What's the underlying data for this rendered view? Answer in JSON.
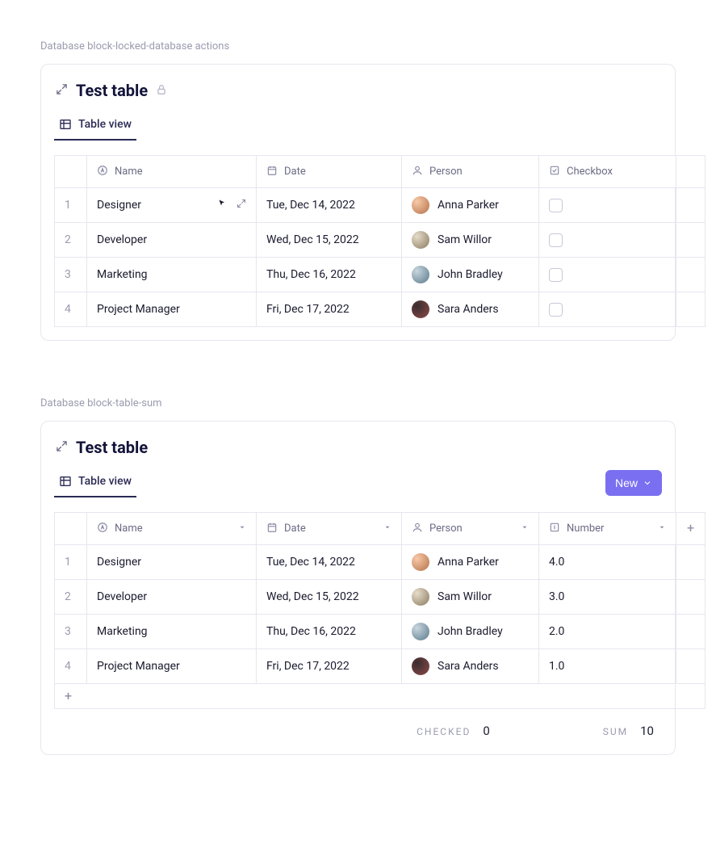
{
  "section1": {
    "caption": "Database block-locked-database actions",
    "title": "Test table",
    "tab": "Table view",
    "columns": {
      "name": "Name",
      "date": "Date",
      "person": "Person",
      "checkbox": "Checkbox"
    },
    "rows": [
      {
        "idx": "1",
        "name": "Designer",
        "date": "Tue, Dec 14, 2022",
        "person": "Anna Parker"
      },
      {
        "idx": "2",
        "name": "Developer",
        "date": "Wed, Dec 15, 2022",
        "person": "Sam Willor"
      },
      {
        "idx": "3",
        "name": "Marketing",
        "date": "Thu, Dec 16, 2022",
        "person": "John Bradley"
      },
      {
        "idx": "4",
        "name": "Project Manager",
        "date": "Fri, Dec 17, 2022",
        "person": "Sara Anders"
      }
    ]
  },
  "section2": {
    "caption": "Database block-table-sum",
    "title": "Test table",
    "tab": "Table view",
    "new_label": "New",
    "columns": {
      "name": "Name",
      "date": "Date",
      "person": "Person",
      "number": "Number"
    },
    "rows": [
      {
        "idx": "1",
        "name": "Designer",
        "date": "Tue, Dec 14, 2022",
        "person": "Anna Parker",
        "number": "4.0"
      },
      {
        "idx": "2",
        "name": "Developer",
        "date": "Wed, Dec 15, 2022",
        "person": "Sam Willor",
        "number": "3.0"
      },
      {
        "idx": "3",
        "name": "Marketing",
        "date": "Thu, Dec 16, 2022",
        "person": "John Bradley",
        "number": "2.0"
      },
      {
        "idx": "4",
        "name": "Project Manager",
        "date": "Fri, Dec 17, 2022",
        "person": "Sara Anders",
        "number": "1.0"
      }
    ],
    "summary": {
      "checked_label": "CHECKED",
      "checked_value": "0",
      "sum_label": "SUM",
      "sum_value": "10"
    }
  }
}
